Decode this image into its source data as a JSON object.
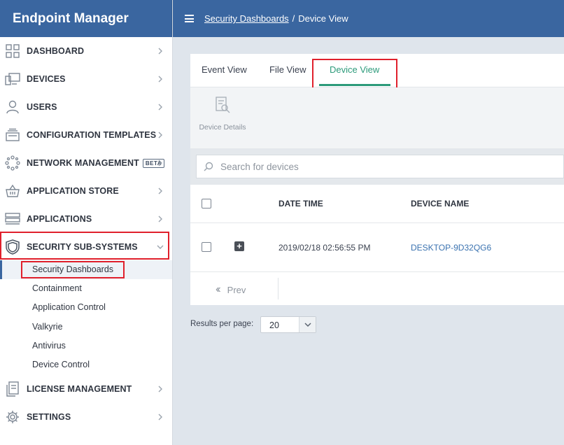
{
  "app": {
    "title": "Endpoint Manager"
  },
  "breadcrumb": {
    "parent": "Security Dashboards",
    "separator": "/",
    "current": "Device View"
  },
  "sidebar": {
    "items": [
      {
        "label": "DASHBOARD",
        "icon": "dashboard-grid-icon"
      },
      {
        "label": "DEVICES",
        "icon": "devices-icon"
      },
      {
        "label": "USERS",
        "icon": "user-icon"
      },
      {
        "label": "CONFIGURATION TEMPLATES",
        "icon": "templates-icon"
      },
      {
        "label": "NETWORK MANAGEMENT",
        "icon": "network-icon",
        "badge": "BETA"
      },
      {
        "label": "APPLICATION STORE",
        "icon": "store-basket-icon"
      },
      {
        "label": "APPLICATIONS",
        "icon": "applications-icon"
      },
      {
        "label": "SECURITY SUB-SYSTEMS",
        "icon": "shield-icon",
        "expanded": true
      },
      {
        "label": "LICENSE MANAGEMENT",
        "icon": "license-icon"
      },
      {
        "label": "SETTINGS",
        "icon": "gear-icon"
      }
    ],
    "security_sub_items": [
      "Security Dashboards",
      "Containment",
      "Application Control",
      "Valkyrie",
      "Antivirus",
      "Device Control"
    ],
    "active_sub_item": "Security Dashboards"
  },
  "tabs": [
    "Event View",
    "File View",
    "Device View"
  ],
  "active_tab": "Device View",
  "toolbar": {
    "device_details_label": "Device Details"
  },
  "search": {
    "placeholder": "Search for devices",
    "value": ""
  },
  "table": {
    "columns": [
      "DATE TIME",
      "DEVICE NAME"
    ],
    "rows": [
      {
        "date_time": "2019/02/18 02:56:55 PM",
        "device_name": "DESKTOP-9D32QG6"
      }
    ]
  },
  "pagination": {
    "prev_label": "Prev",
    "results_per_page_label": "Results per page:",
    "results_per_page": "20"
  },
  "colors": {
    "header": "#3a66a0",
    "accent_green": "#2c9a7a",
    "link": "#3a72b0",
    "highlight_red": "#e0202c"
  }
}
